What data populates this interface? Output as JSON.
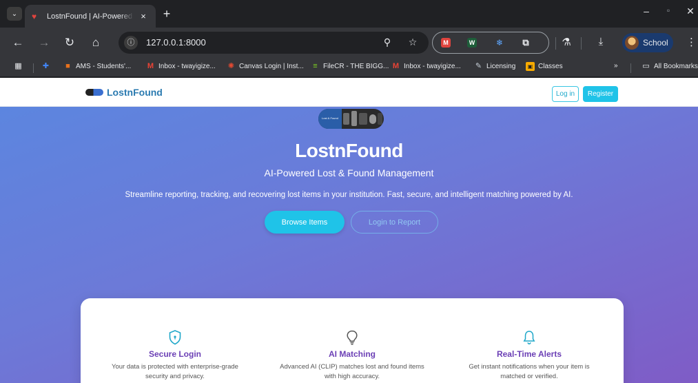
{
  "browser": {
    "tab": {
      "title": "LostnFound | AI-Powered Lo",
      "close": "×"
    },
    "new_tab": "+",
    "window_controls": {
      "minimize": "–",
      "restore": "▫",
      "close": "✕"
    },
    "toolbar": {
      "url": "127.0.0.1:8000",
      "profile_label": "School"
    },
    "bookmarks": [
      {
        "label": "AMS - Students'...",
        "icon": "ams-icon",
        "color": "#e8711c"
      },
      {
        "label": "Inbox - twayigize...",
        "icon": "gmail-icon",
        "color": "#ea4335"
      },
      {
        "label": "Canvas Login | Inst...",
        "icon": "canvas-icon",
        "color": "#e24a32"
      },
      {
        "label": "FileCR - THE BIGG...",
        "icon": "filecr-icon",
        "color": "#7ed321"
      },
      {
        "label": "Inbox - twayigize...",
        "icon": "gmail-icon",
        "color": "#ea4335"
      },
      {
        "label": "Licensing",
        "icon": "licensing-icon",
        "color": "#c8d0d8"
      },
      {
        "label": "Classes",
        "icon": "classroom-icon",
        "color": "#f9ab00"
      }
    ],
    "bookmarks_overflow": "»",
    "all_bookmarks": "All Bookmarks"
  },
  "site": {
    "brand": "LostnFound",
    "login_label": "Log in",
    "register_label": "Register",
    "hero": {
      "image_caption": "Lost & Found",
      "title": "LostnFound",
      "subtitle": "AI-Powered Lost & Found Management",
      "description": "Streamline reporting, tracking, and recovering lost items in your institution. Fast, secure, and intelligent matching powered by AI.",
      "browse_label": "Browse Items",
      "report_label": "Login to Report"
    },
    "features": [
      {
        "icon": "shield-icon",
        "title": "Secure Login",
        "text_1": "Your data is protected with enterprise-grade",
        "text_2": "security and privacy."
      },
      {
        "icon": "lightbulb-icon",
        "title": "AI Matching",
        "text_1": "Advanced AI (CLIP) matches lost and found items",
        "text_2": "with high accuracy."
      },
      {
        "icon": "bell-icon",
        "title": "Real-Time Alerts",
        "text_1": "Get instant notifications when your item is",
        "text_2": "matched or verified."
      }
    ]
  },
  "colors": {
    "accent": "#1fc3e8",
    "feature_title": "#6b3fb5",
    "gradient_start": "#5a87e0",
    "gradient_end": "#7f5cc6"
  }
}
